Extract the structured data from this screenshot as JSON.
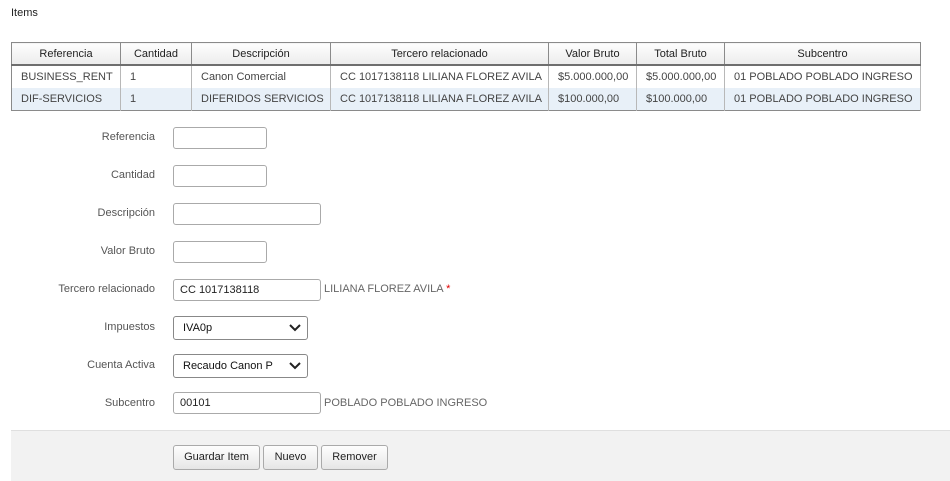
{
  "section_title": "Items",
  "table": {
    "headers": [
      "Referencia",
      "Cantidad",
      "Descripción",
      "Tercero relacionado",
      "Valor Bruto",
      "Total Bruto",
      "Subcentro"
    ],
    "rows": [
      [
        "BUSINESS_RENT",
        "1",
        "Canon Comercial",
        "CC 1017138118 LILIANA FLOREZ AVILA",
        "$5.000.000,00",
        "$5.000.000,00",
        "01 POBLADO POBLADO INGRESO"
      ],
      [
        "DIF-SERVICIOS",
        "1",
        "DIFERIDOS SERVICIOS",
        "CC 1017138118 LILIANA FLOREZ AVILA",
        "$100.000,00",
        "$100.000,00",
        "01 POBLADO POBLADO INGRESO"
      ]
    ]
  },
  "form": {
    "referencia": {
      "label": "Referencia",
      "value": ""
    },
    "cantidad": {
      "label": "Cantidad",
      "value": ""
    },
    "descripcion": {
      "label": "Descripción",
      "value": ""
    },
    "valor_bruto": {
      "label": "Valor Bruto",
      "value": ""
    },
    "tercero": {
      "label": "Tercero relacionado",
      "value": "CC 1017138118",
      "name": "LILIANA FLOREZ AVILA",
      "required_mark": "*"
    },
    "impuestos": {
      "label": "Impuestos",
      "selected": "IVA0p"
    },
    "cuenta_activa": {
      "label": "Cuenta Activa",
      "selected": "Recaudo Canon P"
    },
    "subcentro": {
      "label": "Subcentro",
      "value": "00101",
      "name": "POBLADO POBLADO INGRESO"
    }
  },
  "buttons": {
    "guardar": "Guardar Item",
    "nuevo": "Nuevo",
    "remover": "Remover"
  }
}
